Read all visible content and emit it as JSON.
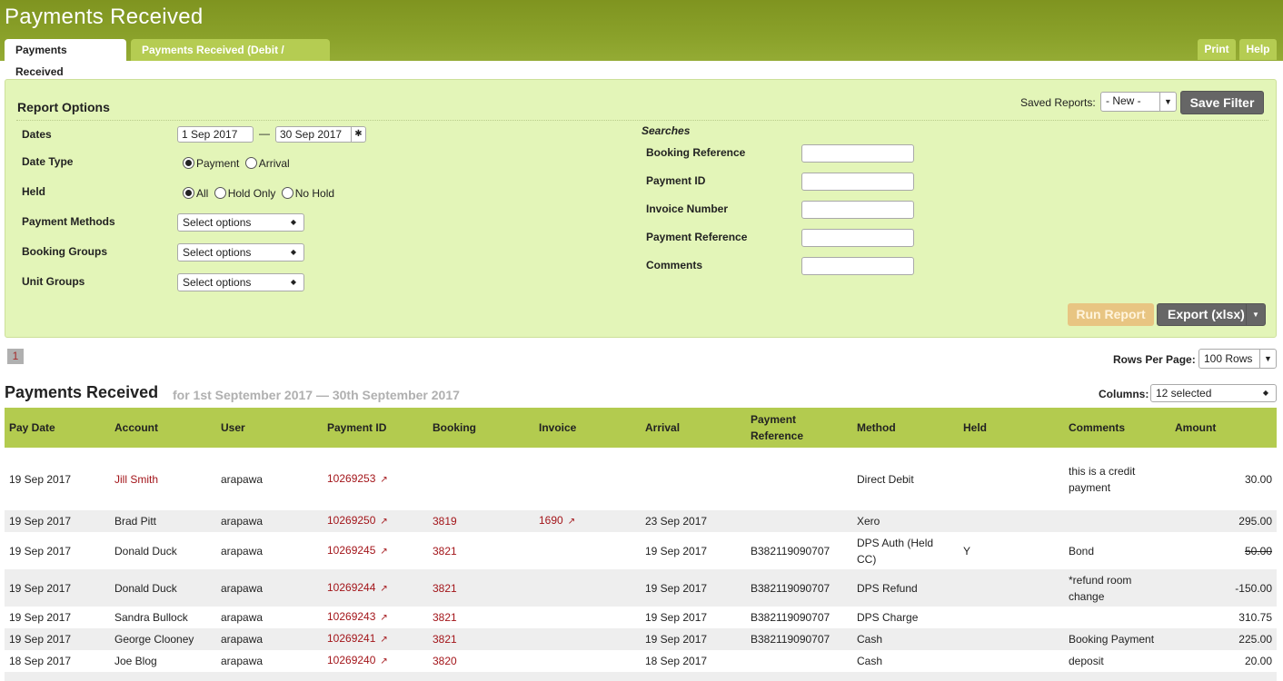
{
  "header": {
    "title": "Payments Received"
  },
  "tabs": [
    {
      "label": "Payments Received",
      "active": true
    },
    {
      "label": "Payments Received (Debit / Credit)",
      "active": false
    }
  ],
  "top_buttons": {
    "print": "Print",
    "help": "Help"
  },
  "report_options": {
    "title": "Report Options",
    "saved_reports_label": "Saved Reports:",
    "saved_reports_value": "- New -",
    "save_filter": "Save Filter",
    "dates_label": "Dates",
    "date_from": "1 Sep 2017",
    "date_sep": "—",
    "date_to": "30 Sep 2017",
    "date_type_label": "Date Type",
    "date_type_options": [
      "Payment",
      "Arrival"
    ],
    "held_label": "Held",
    "held_options": [
      "All",
      "Hold Only",
      "No Hold"
    ],
    "payment_methods_label": "Payment Methods",
    "booking_groups_label": "Booking Groups",
    "unit_groups_label": "Unit Groups",
    "select_placeholder": "Select options",
    "searches_title": "Searches",
    "search_fields": [
      "Booking Reference",
      "Payment ID",
      "Invoice Number",
      "Payment Reference",
      "Comments"
    ],
    "run_report": "Run Report",
    "export": "Export (xlsx)"
  },
  "pager": {
    "current": "1",
    "rows_per_page_label": "Rows Per Page:",
    "rows_per_page_value": "100 Rows"
  },
  "report": {
    "title": "Payments Received",
    "subtitle": "for 1st September 2017 — 30th September 2017",
    "columns_label": "Columns:",
    "columns_value": "12 selected",
    "headers": [
      "Pay Date",
      "Account",
      "User",
      "Payment ID",
      "Booking",
      "Invoice",
      "Arrival",
      "Payment Reference",
      "Method",
      "Held",
      "Comments",
      "Amount"
    ],
    "rows": [
      {
        "pay_date": "19 Sep 2017",
        "account": "Jill Smith",
        "user": "arapawa",
        "payment_id": "10269253",
        "booking": "",
        "invoice": "",
        "arrival": "",
        "payment_ref": "",
        "method": "Direct Debit",
        "held": "",
        "comments": "this is a credit payment",
        "amount": "30.00"
      },
      {
        "pay_date": "19 Sep 2017",
        "account": "Brad Pitt",
        "user": "arapawa",
        "payment_id": "10269250",
        "booking": "3819",
        "invoice": "1690",
        "arrival": "23 Sep 2017",
        "payment_ref": "",
        "method": "Xero",
        "held": "",
        "comments": "",
        "amount": "295.00"
      },
      {
        "pay_date": "19 Sep 2017",
        "account": "Donald Duck",
        "user": "arapawa",
        "payment_id": "10269245",
        "booking": "3821",
        "invoice": "",
        "arrival": "19 Sep 2017",
        "payment_ref": "B382119090707",
        "method": "DPS Auth (Held CC)",
        "held": "Y",
        "comments": "Bond",
        "amount": "50.00"
      },
      {
        "pay_date": "19 Sep 2017",
        "account": "Donald Duck",
        "user": "arapawa",
        "payment_id": "10269244",
        "booking": "3821",
        "invoice": "",
        "arrival": "19 Sep 2017",
        "payment_ref": "B382119090707",
        "method": "DPS Refund",
        "held": "",
        "comments": "*refund room change",
        "amount": "-150.00"
      },
      {
        "pay_date": "19 Sep 2017",
        "account": "Sandra Bullock",
        "user": "arapawa",
        "payment_id": "10269243",
        "booking": "3821",
        "invoice": "",
        "arrival": "19 Sep 2017",
        "payment_ref": "B382119090707",
        "method": "DPS Charge",
        "held": "",
        "comments": "",
        "amount": "310.75"
      },
      {
        "pay_date": "19 Sep 2017",
        "account": "George Clooney",
        "user": "arapawa",
        "payment_id": "10269241",
        "booking": "3821",
        "invoice": "",
        "arrival": "19 Sep 2017",
        "payment_ref": "B382119090707",
        "method": "Cash",
        "held": "",
        "comments": "Booking Payment",
        "amount": "225.00"
      },
      {
        "pay_date": "18 Sep 2017",
        "account": "Joe Blog",
        "user": "arapawa",
        "payment_id": "10269240",
        "booking": "3820",
        "invoice": "",
        "arrival": "18 Sep 2017",
        "payment_ref": "",
        "method": "Cash",
        "held": "",
        "comments": "deposit",
        "amount": "20.00"
      }
    ]
  },
  "colors": {
    "header_green": "#8aa12a",
    "tab_green": "#b5cc52",
    "panel_green": "#e3f5b8",
    "table_header": "#b3cb4f",
    "link": "#a3151a"
  }
}
